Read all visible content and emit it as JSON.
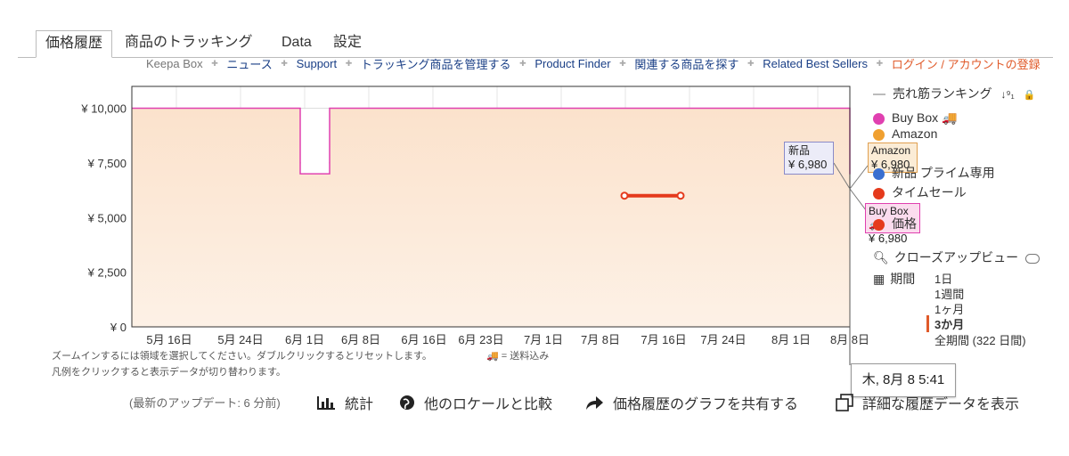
{
  "tabs": [
    "価格履歴",
    "商品のトラッキング",
    "Data",
    "設定"
  ],
  "nav": {
    "keepa_box": "Keepa Box",
    "links": [
      "ニュース",
      "Support",
      "トラッキング商品を管理する",
      "Product Finder",
      "関連する商品を探す",
      "Related Best Sellers"
    ],
    "login": "ログイン / アカウントの登録"
  },
  "chart_data": {
    "type": "line",
    "x": [
      "5月 16日",
      "5月 24日",
      "6月 1日",
      "6月 8日",
      "6月 16日",
      "6月 23日",
      "7月 1日",
      "7月 8日",
      "7月 16日",
      "7月 24日",
      "8月 1日",
      "8月 8日"
    ],
    "y_ticks": [
      "¥ 0",
      "¥ 2,500",
      "¥ 5,000",
      "¥ 7,500",
      "¥ 10,000"
    ],
    "ylim": [
      0,
      11000
    ],
    "series": [
      {
        "name": "Buy Box",
        "color": "#e040b0",
        "points": [
          [
            "5月 9日",
            10000
          ],
          [
            "6月 1日",
            10000
          ],
          [
            "6月 1日",
            7000
          ],
          [
            "6月 3日",
            7000
          ],
          [
            "6月 3日",
            10000
          ],
          [
            "8月 8日",
            10000
          ],
          [
            "8月 8日",
            6980
          ]
        ]
      },
      {
        "name": "タイムセール",
        "color": "#e53a1c",
        "points": [
          [
            "7月 10日",
            6000
          ],
          [
            "7月 18日",
            6000
          ]
        ]
      }
    ],
    "tooltips": [
      {
        "label": "新品",
        "value": "¥ 6,980"
      },
      {
        "label": "Amazon",
        "value": "¥ 6,980"
      },
      {
        "label": "Buy Box 🚚",
        "value": "¥ 6,980"
      }
    ]
  },
  "legend": {
    "sales_rank": "売れ筋ランキング",
    "items": [
      {
        "label": "Buy Box 🚚",
        "color": "#e040b0"
      },
      {
        "label": "Amazon",
        "color": "#f0a030"
      },
      {
        "label": "新品 プライム専用",
        "color": "#3a6fd0"
      },
      {
        "label": "タイムセール",
        "color": "#e53a1c"
      },
      {
        "label": "価格",
        "color": "#e53a1c"
      }
    ],
    "close_up": "クローズアップビュー",
    "period_label": "期間",
    "periods": [
      "1日",
      "1週間",
      "1ヶ月",
      "3か月",
      "全期間 (322 日間)"
    ],
    "selected_period": "3か月"
  },
  "notes": {
    "zoom": "ズームインするには領域を選択してください。ダブルクリックするとリセットします。",
    "shipping": "🚚 = 送料込み",
    "legend_hint": "凡例をクリックすると表示データが切り替わります。"
  },
  "hover_date": "木, 8月 8 5:41",
  "footer": {
    "last_update": "(最新のアップデート: 6 分前)",
    "stats": "統計",
    "compare": "他のロケールと比較",
    "share": "価格履歴のグラフを共有する",
    "details": "詳細な履歴データを表示"
  }
}
